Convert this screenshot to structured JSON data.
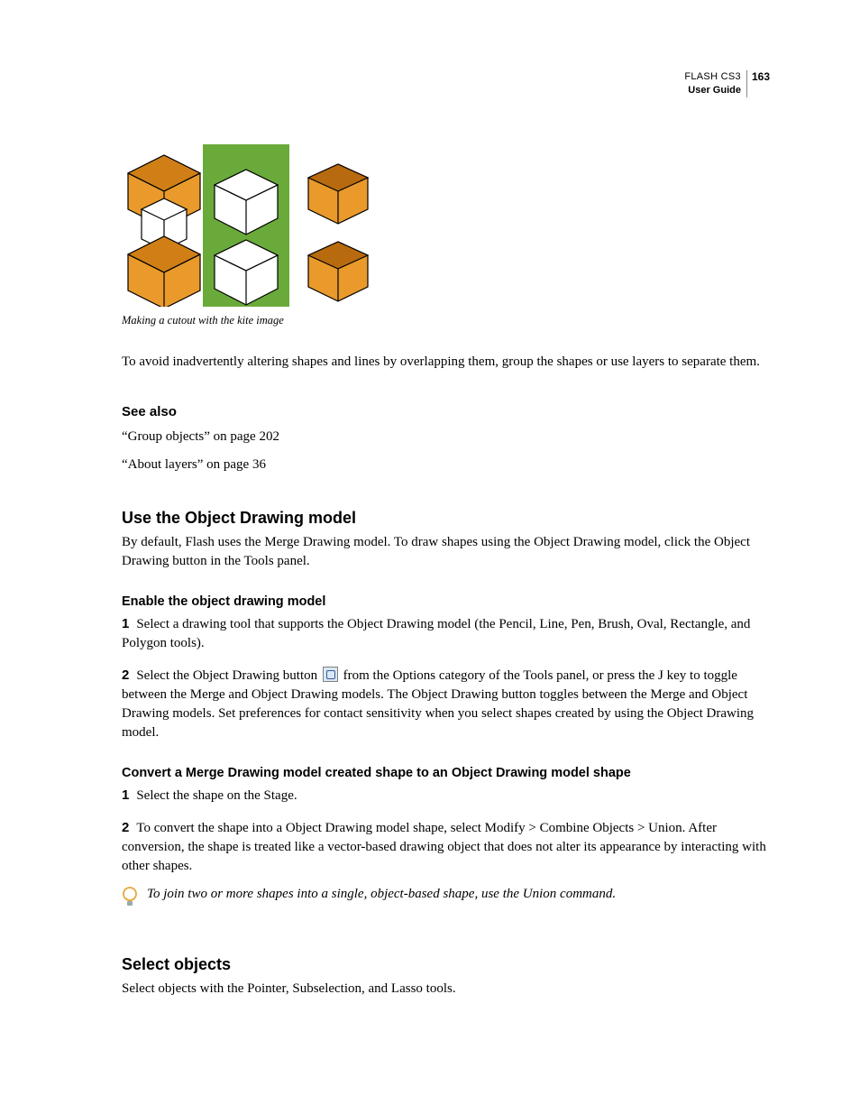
{
  "header": {
    "product": "FLASH CS3",
    "guide": "User Guide",
    "page_number": "163"
  },
  "figure": {
    "caption": "Making a cutout with the kite image"
  },
  "intro_paragraph": "To avoid inadvertently altering shapes and lines by overlapping them, group the shapes or use layers to separate them.",
  "see_also": {
    "heading": "See also",
    "links": [
      "“Group objects” on page 202",
      "“About layers” on page 36"
    ]
  },
  "section1": {
    "heading": "Use the Object Drawing model",
    "body": "By default, Flash uses the Merge Drawing model. To draw shapes using the Object Drawing model, click the Object Drawing button in the Tools panel.",
    "sub1": {
      "heading": "Enable the object drawing model",
      "step1_num": "1",
      "step1_text": "Select a drawing tool that supports the Object Drawing model (the Pencil, Line, Pen, Brush, Oval, Rectangle, and Polygon tools).",
      "step2_num": "2",
      "step2_text_a": "Select the Object Drawing button ",
      "step2_text_b": " from the Options category of the Tools panel, or press the J key to toggle between the Merge and Object Drawing models. The Object Drawing button toggles between the Merge and Object Drawing models. Set preferences for contact sensitivity when you select shapes created by using the Object Drawing model."
    },
    "sub2": {
      "heading": "Convert a Merge Drawing model created shape to an Object Drawing model shape",
      "step1_num": "1",
      "step1_text": "Select the shape on the Stage.",
      "step2_num": "2",
      "step2_text": "To convert the shape into a Object Drawing model shape, select Modify > Combine Objects > Union. After conversion, the shape is treated like a vector-based drawing object that does not alter its appearance by interacting with other shapes.",
      "tip": "To join two or more shapes into a single, object-based shape, use the Union command."
    }
  },
  "section2": {
    "heading": "Select objects",
    "body": "Select objects with the Pointer, Subselection, and Lasso tools."
  }
}
